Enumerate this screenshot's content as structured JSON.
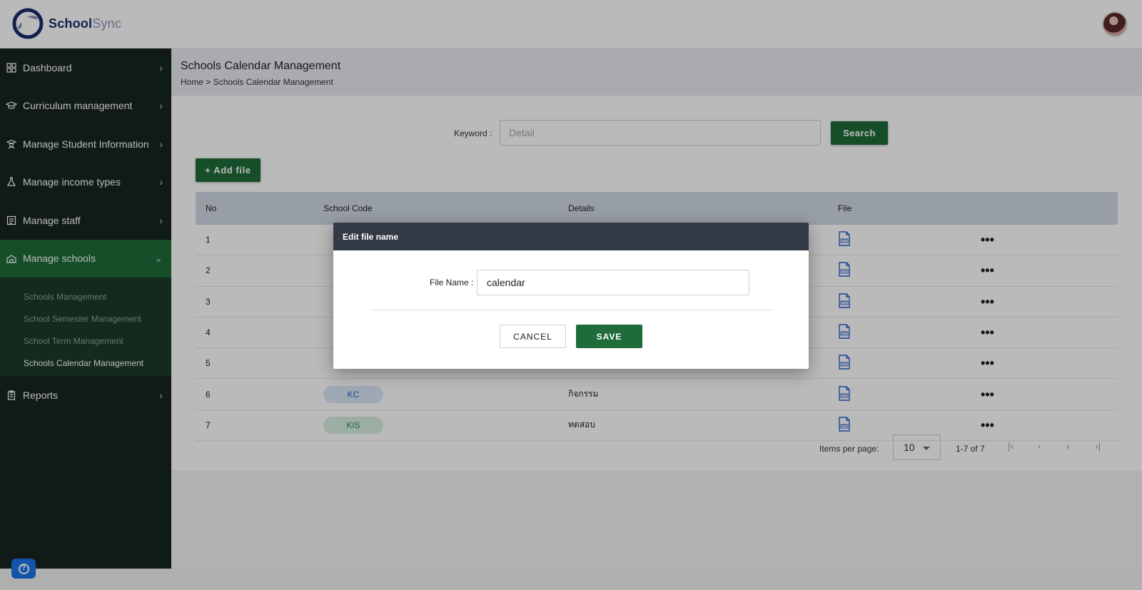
{
  "app": {
    "brand_part1": "School",
    "brand_part2": "Sync"
  },
  "sidebar": {
    "items": [
      {
        "label": "Dashboard",
        "icon": "grid-icon"
      },
      {
        "label": "Curriculum management",
        "icon": "graduation-cap-icon"
      },
      {
        "label": "Manage Student Information",
        "icon": "student-icon"
      },
      {
        "label": "Manage income types",
        "icon": "flask-icon"
      },
      {
        "label": "Manage staff",
        "icon": "id-card-icon"
      },
      {
        "label": "Manage schools",
        "icon": "school-icon"
      },
      {
        "label": "Reports",
        "icon": "clipboard-icon"
      }
    ],
    "submenu": [
      {
        "label": "Schools Management"
      },
      {
        "label": "School Semester Management"
      },
      {
        "label": "School Term Management"
      },
      {
        "label": "Schools Calendar Management"
      }
    ]
  },
  "page": {
    "title": "Schools Calendar Management",
    "breadcrumb": "Home > Schools Calendar Management"
  },
  "search": {
    "label": "Keyword :",
    "placeholder": "Detail",
    "button": "Search"
  },
  "add_button": "+ Add file",
  "table": {
    "headers": {
      "no": "No",
      "code": "School Code",
      "details": "Details",
      "file": "File"
    },
    "rows": [
      {
        "no": "1",
        "code": "",
        "details": ""
      },
      {
        "no": "2",
        "code": "",
        "details": ""
      },
      {
        "no": "3",
        "code": "",
        "details": ""
      },
      {
        "no": "4",
        "code": "",
        "details": ""
      },
      {
        "no": "5",
        "code": "",
        "details": ""
      },
      {
        "no": "6",
        "code": "KC",
        "details": "กิจกรรม"
      },
      {
        "no": "7",
        "code": "KIS",
        "details": "ทดสอบ"
      }
    ]
  },
  "pager": {
    "label": "Items per page:",
    "page_size": "10",
    "range": "1-7 of 7"
  },
  "modal": {
    "title": "Edit file name",
    "field_label": "File Name :",
    "field_value": "calendar",
    "cancel": "CANCEL",
    "save": "SAVE"
  },
  "colors": {
    "brand_green": "#1f6b3a",
    "sidebar_bg": "#17241f",
    "chip_blue": "#dbe7f7",
    "chip_green": "#d7f0e1"
  }
}
